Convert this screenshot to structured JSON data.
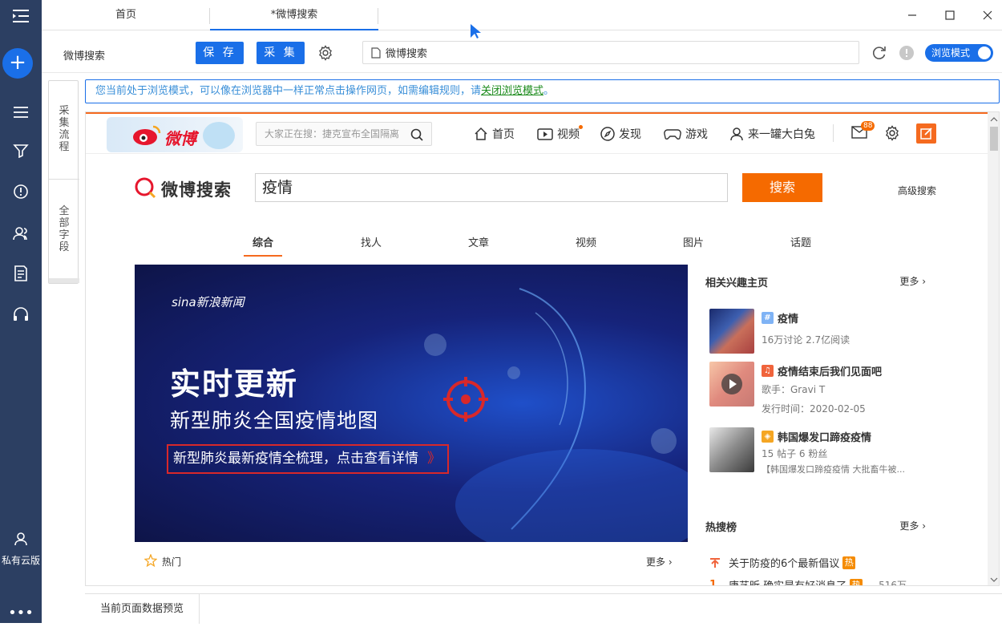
{
  "app": {
    "tabs": [
      {
        "label": "首页"
      },
      {
        "label": "*微博搜索"
      }
    ],
    "nav": {
      "private_label": "私有云版"
    }
  },
  "toolbar": {
    "task_name": "微博搜索",
    "save_label": "保 存",
    "collect_label": "采 集",
    "url_text": "微博搜索",
    "mode_label": "浏览模式"
  },
  "side_tabs": [
    {
      "label": [
        "采",
        "集",
        "流",
        "程"
      ]
    },
    {
      "label": [
        "全",
        "部",
        "字",
        "段"
      ]
    }
  ],
  "notice": {
    "text": "您当前处于浏览模式，可以像在浏览器中一样正常点击操作网页，如需编辑规则，请",
    "link": "关闭浏览模式",
    "suffix": "。"
  },
  "weibo": {
    "logo_text": "微博",
    "search_placeholder": "大家正在搜：捷克宣布全国隔离",
    "nav": [
      "首页",
      "视频",
      "发现",
      "游戏",
      "来一罐大白兔"
    ],
    "mail_badge": "88",
    "search_brand": "微博搜索",
    "query": "疫情",
    "search_button": "搜索",
    "advanced": "高级搜索",
    "sub_tabs": [
      "综合",
      "找人",
      "文章",
      "视频",
      "图片",
      "话题"
    ],
    "banner": {
      "brand": "sina新浪新闻",
      "headline": "实时更新",
      "subhead": "新型肺炎全国疫情地图",
      "cta": "新型肺炎最新疫情全梳理，点击查看详情"
    },
    "hot_label": "热门",
    "hot_more": "更多 ›",
    "related": {
      "title": "相关兴趣主页",
      "more": "更多 ›",
      "items": [
        {
          "name": "疫情",
          "line1": "16万讨论 2.7亿阅读",
          "line2": ""
        },
        {
          "name": "疫情结束后我们见面吧",
          "line1": "歌手：Gravi T",
          "line2": "发行时间：2020-02-05"
        },
        {
          "name": "韩国爆发口蹄疫疫情",
          "line1": "15 帖子 6 粉丝",
          "line2": "【韩国爆发口蹄疫疫情 大批畜牛被..."
        }
      ]
    },
    "hot_search": {
      "title": "热搜榜",
      "more": "更多 ›",
      "items": [
        {
          "rank": "",
          "text": "关于防疫的6个最新倡议",
          "tag": "热",
          "count": ""
        },
        {
          "rank": "1",
          "text": "唐艺昕 确实是有好消息了",
          "tag": "热",
          "count": "516万"
        }
      ]
    }
  },
  "bottom": {
    "preview_label": "当前页面数据预览"
  },
  "colors": {
    "nav_bg": "#2c3f62",
    "accent": "#1a6fe8",
    "weibo_orange": "#f56a00"
  }
}
